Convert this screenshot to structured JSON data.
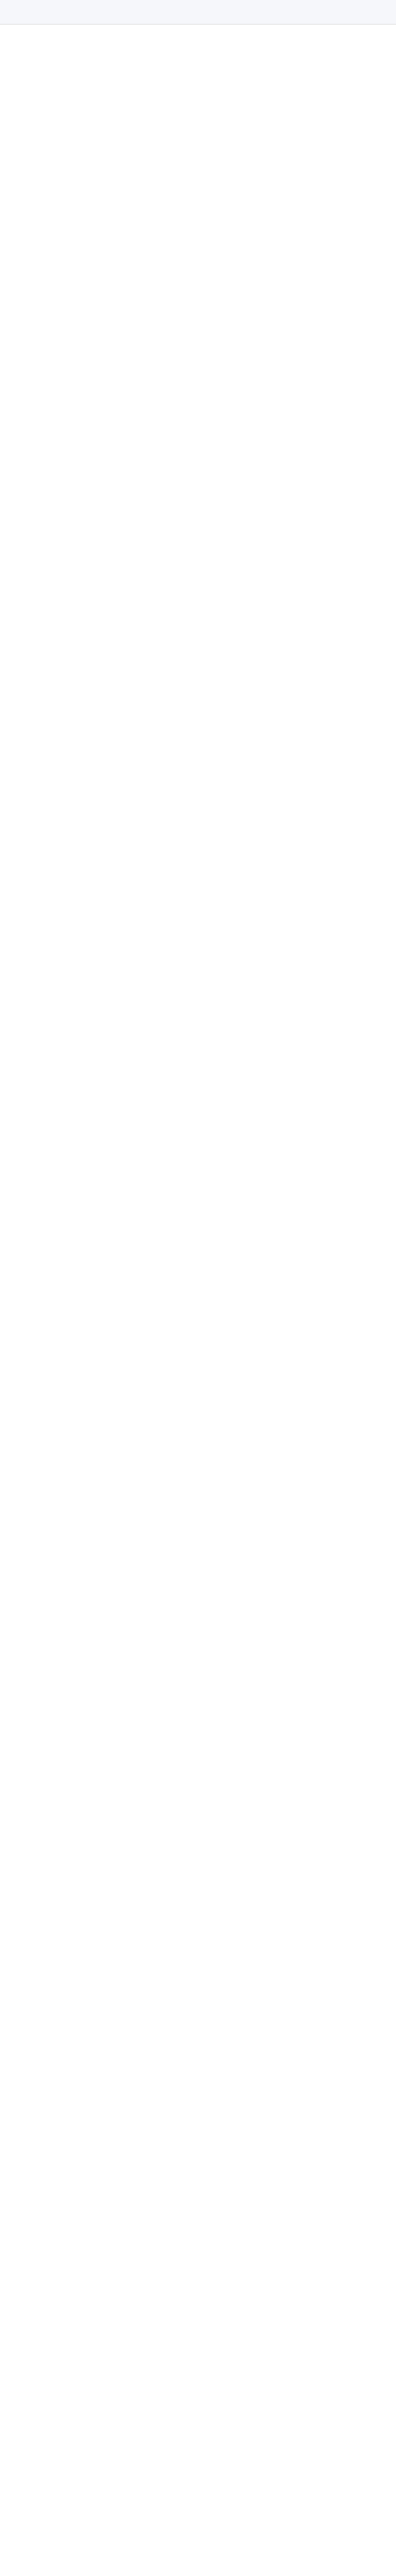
{
  "table": {
    "columns": [],
    "rows": []
  }
}
